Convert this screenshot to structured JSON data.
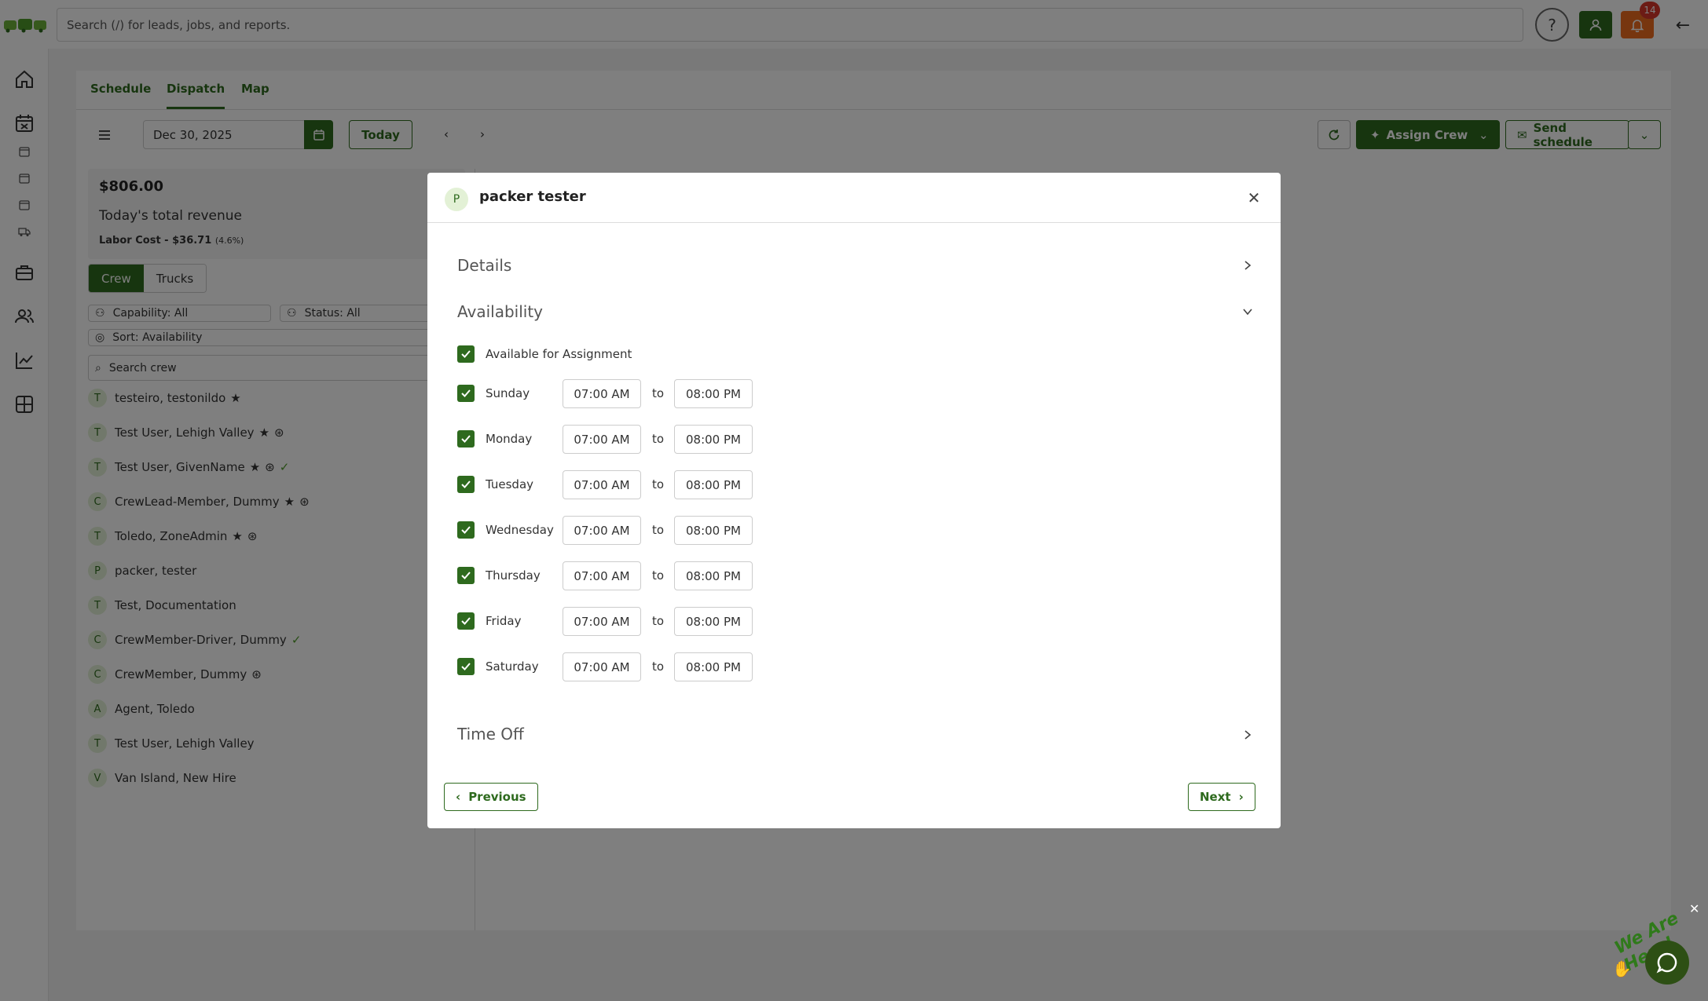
{
  "topbar": {
    "search_placeholder": "Search (/) for leads, jobs, and reports.",
    "help_label": "?",
    "notification_count": "14"
  },
  "tabs": [
    {
      "label": "Schedule"
    },
    {
      "label": "Dispatch"
    },
    {
      "label": "Map"
    }
  ],
  "toolbar": {
    "date": "Dec 30, 2025",
    "today_label": "Today",
    "assign_crew_label": "Assign Crew",
    "send_schedule_label": "Send schedule"
  },
  "revenue": {
    "amount": "$806.00",
    "label": "Today's total revenue",
    "labor_cost": "Labor Cost - $36.71",
    "labor_pct": "(4.6%)"
  },
  "segment": {
    "crew_label": "Crew",
    "trucks_label": "Trucks"
  },
  "filters": {
    "capability": "Capability: All",
    "status": "Status: All",
    "sort": "Sort: Availability",
    "search_placeholder": "Search crew"
  },
  "crew": [
    {
      "initial": "T",
      "name": "testeiro, testonildo"
    },
    {
      "initial": "T",
      "name": "Test User, Lehigh Valley"
    },
    {
      "initial": "T",
      "name": "Test User, GivenName"
    },
    {
      "initial": "C",
      "name": "CrewLead-Member, Dummy"
    },
    {
      "initial": "T",
      "name": "Toledo, ZoneAdmin"
    },
    {
      "initial": "P",
      "name": "packer, tester"
    },
    {
      "initial": "T",
      "name": "Test, Documentation"
    },
    {
      "initial": "C",
      "name": "CrewMember-Driver, Dummy"
    },
    {
      "initial": "C",
      "name": "CrewMember, Dummy"
    },
    {
      "initial": "A",
      "name": "Agent, Toledo"
    },
    {
      "initial": "T",
      "name": "Test User, Lehigh Valley"
    },
    {
      "initial": "V",
      "name": "Van Island, New Hire"
    }
  ],
  "modal": {
    "avatar_initial": "P",
    "title": "packer tester",
    "details_label": "Details",
    "availability_label": "Availability",
    "available_label": "Available for Assignment",
    "to_label": "to",
    "days": [
      {
        "day": "Sunday",
        "from": "07:00 AM",
        "to": "08:00 PM"
      },
      {
        "day": "Monday",
        "from": "07:00 AM",
        "to": "08:00 PM"
      },
      {
        "day": "Tuesday",
        "from": "07:00 AM",
        "to": "08:00 PM"
      },
      {
        "day": "Wednesday",
        "from": "07:00 AM",
        "to": "08:00 PM"
      },
      {
        "day": "Thursday",
        "from": "07:00 AM",
        "to": "08:00 PM"
      },
      {
        "day": "Friday",
        "from": "07:00 AM",
        "to": "08:00 PM"
      },
      {
        "day": "Saturday",
        "from": "07:00 AM",
        "to": "08:00 PM"
      }
    ],
    "time_off_label": "Time Off",
    "previous_label": "Previous",
    "next_label": "Next"
  },
  "chat": {
    "tagline": "We Are Here!"
  },
  "colors": {
    "brand_green": "#2e6a1e",
    "notification_orange": "#ef6c1e",
    "badge_red": "#d9362a"
  }
}
